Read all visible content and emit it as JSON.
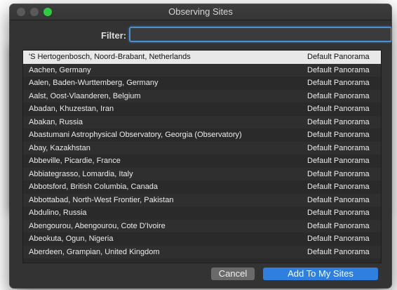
{
  "window": {
    "title": "Observing Sites"
  },
  "filter": {
    "label": "Filter:",
    "value": "",
    "placeholder": ""
  },
  "sites": [
    {
      "name": "'S Hertogenbosch, Noord-Brabant, Netherlands",
      "panorama": "Default Panorama",
      "selected": true
    },
    {
      "name": "Aachen, Germany",
      "panorama": "Default Panorama"
    },
    {
      "name": "Aalen, Baden-Wurttemberg, Germany",
      "panorama": "Default Panorama"
    },
    {
      "name": "Aalst, Oost-Vlaanderen, Belgium",
      "panorama": "Default Panorama"
    },
    {
      "name": "Abadan, Khuzestan, Iran",
      "panorama": "Default Panorama"
    },
    {
      "name": "Abakan, Russia",
      "panorama": "Default Panorama"
    },
    {
      "name": "Abastumani Astrophysical Observatory, Georgia (Observatory)",
      "panorama": "Default Panorama"
    },
    {
      "name": "Abay, Kazakhstan",
      "panorama": "Default Panorama"
    },
    {
      "name": "Abbeville, Picardie, France",
      "panorama": "Default Panorama"
    },
    {
      "name": "Abbiategrasso, Lomardia, Italy",
      "panorama": "Default Panorama"
    },
    {
      "name": "Abbotsford, British Columbia, Canada",
      "panorama": "Default Panorama"
    },
    {
      "name": "Abbottabad, North-West Frontier, Pakistan",
      "panorama": "Default Panorama"
    },
    {
      "name": "Abdulino, Russia",
      "panorama": "Default Panorama"
    },
    {
      "name": "Abengourou, Abengourou, Cote D'Ivoire",
      "panorama": "Default Panorama"
    },
    {
      "name": "Abeokuta, Ogun, Nigeria",
      "panorama": "Default Panorama"
    },
    {
      "name": "Aberdeen, Grampian, United Kingdom",
      "panorama": "Default Panorama"
    }
  ],
  "buttons": {
    "cancel": "Cancel",
    "add": "Add To My Sites"
  },
  "colors": {
    "accent": "#2f7fe0",
    "dialog_bg": "#333333",
    "list_bg": "#2a2a2a",
    "selected_row": "#e8e8e8"
  }
}
